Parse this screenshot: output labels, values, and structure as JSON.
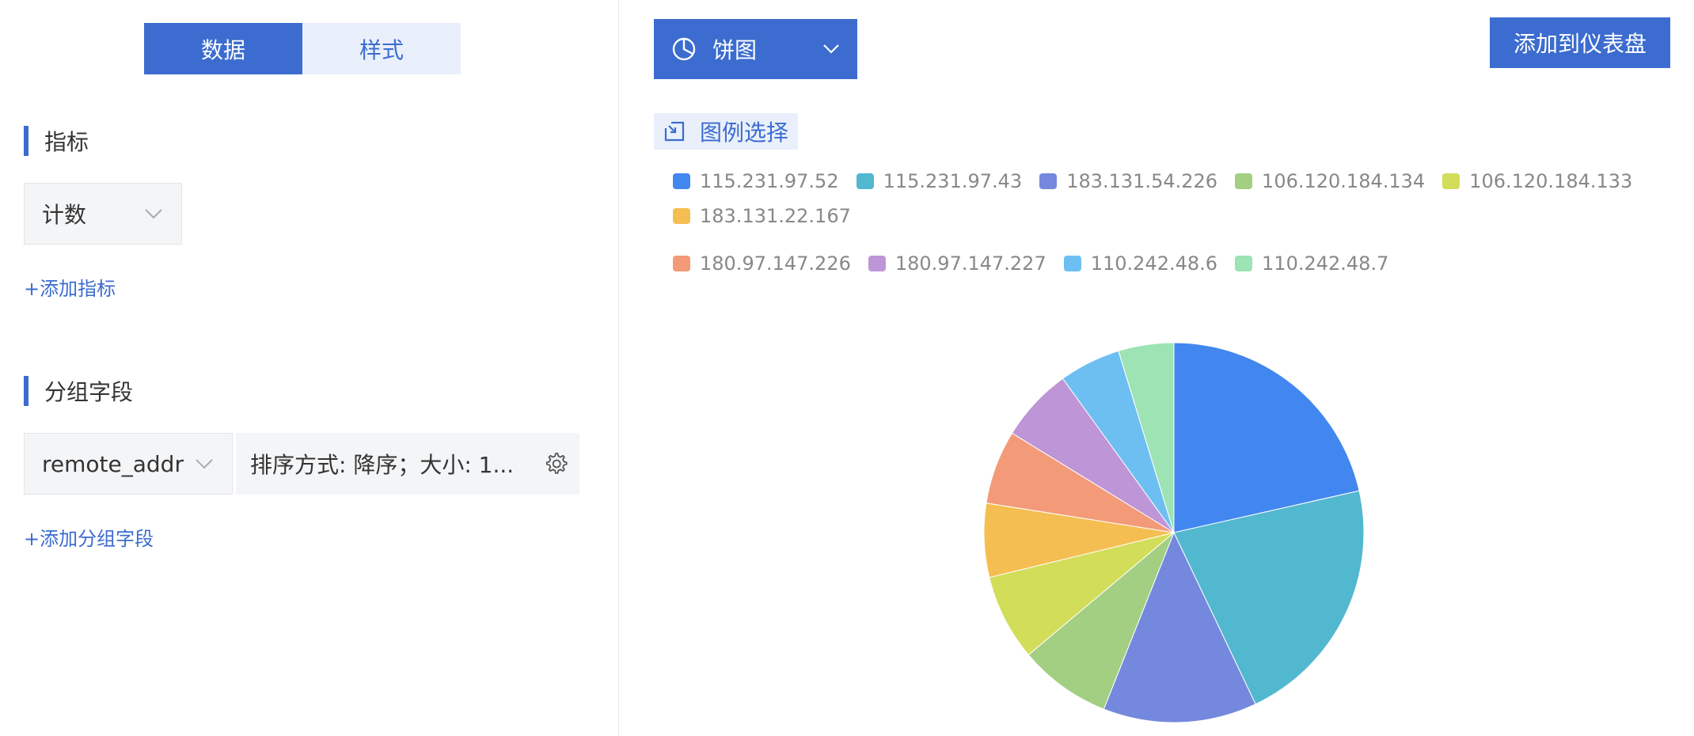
{
  "tabs": [
    {
      "label": "数据",
      "active": true
    },
    {
      "label": "样式",
      "active": false
    }
  ],
  "metrics": {
    "title": "指标",
    "selected": "计数",
    "add_label": "+添加指标"
  },
  "group": {
    "title": "分组字段",
    "field": "remote_addr",
    "sort_text": "排序方式: 降序；大小: 1...",
    "add_label": "+添加分组字段"
  },
  "chart_type": {
    "label": "饼图",
    "icon": "pie-chart-icon"
  },
  "add_dashboard_label": "添加到仪表盘",
  "legend_select_label": "图例选择",
  "colors": {
    "accent": "#3c6ccf"
  },
  "chart_data": {
    "type": "pie",
    "categories": [
      "115.231.97.52",
      "115.231.97.43",
      "183.131.54.226",
      "106.120.184.134",
      "106.120.184.133",
      "183.131.22.167",
      "180.97.147.226",
      "180.97.147.227",
      "110.242.48.6",
      "110.242.48.7"
    ],
    "values": [
      20.5,
      20.5,
      12.5,
      7.5,
      7.0,
      6.0,
      6.0,
      6.0,
      5.0,
      4.5
    ],
    "colors": [
      "#4287f0",
      "#52b8cf",
      "#7489dd",
      "#a2cf82",
      "#d2dd59",
      "#f5be52",
      "#f39a78",
      "#be95d6",
      "#6ebff1",
      "#9de3b4"
    ],
    "legend": "top"
  }
}
